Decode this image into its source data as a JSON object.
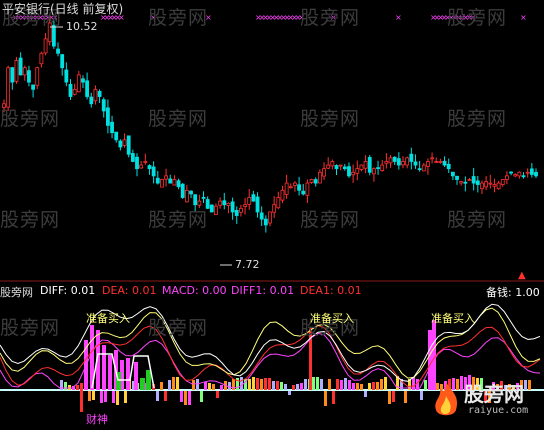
{
  "main": {
    "title": "平安银行(日线 前复权)",
    "high_label": "10.52",
    "low_label": "7.72",
    "watermark": "股旁网",
    "prices": [
      9.4,
      9.9,
      9.7,
      10.0,
      9.8,
      9.9,
      9.7,
      9.6,
      9.9,
      10.1,
      10.3,
      10.52,
      10.2,
      10.1,
      9.9,
      9.7,
      9.5,
      9.6,
      9.8,
      9.7,
      9.5,
      9.4,
      9.6,
      9.5,
      9.3,
      9.1,
      9.0,
      8.9,
      8.8,
      8.9,
      8.7,
      8.6,
      8.5,
      8.55,
      8.6,
      8.5,
      8.4,
      8.3,
      8.35,
      8.4,
      8.3,
      8.35,
      8.25,
      8.1,
      8.2,
      8.15,
      8.0,
      8.05,
      8.1,
      7.95,
      7.9,
      7.98,
      8.05,
      8.0,
      8.02,
      7.9,
      7.85,
      7.95,
      8.0,
      8.1,
      8.05,
      7.9,
      7.8,
      7.72,
      7.9,
      8.0,
      8.1,
      8.2,
      8.3,
      8.25,
      8.3,
      8.2,
      8.15,
      8.3,
      8.35,
      8.3,
      8.45,
      8.5,
      8.55,
      8.6,
      8.5,
      8.55,
      8.5,
      8.4,
      8.45,
      8.5,
      8.55,
      8.6,
      8.45,
      8.5,
      8.5,
      8.55,
      8.6,
      8.65,
      8.6,
      8.55,
      8.6,
      8.65,
      8.6,
      8.55,
      8.5,
      8.55,
      8.6,
      8.65,
      8.6,
      8.6,
      8.55,
      8.5,
      8.4,
      8.35,
      8.32,
      8.3,
      8.35,
      8.3,
      8.28,
      8.3,
      8.32,
      8.3,
      8.28,
      8.3,
      8.35,
      8.4,
      8.45,
      8.42,
      8.45,
      8.4,
      8.45,
      8.42,
      8.4
    ],
    "price_range": [
      7.4,
      10.7
    ]
  },
  "indicator": {
    "name": "股旁网",
    "diff": "DIFF: 0.01",
    "dea": "DEA: 0.01",
    "macd": "MACD: 0.00",
    "diff1": "DIFF1: 0.01",
    "dea1": "DEA1: 0.01",
    "beiqian": "备钱: 1.00",
    "buy_label": "准备买入",
    "caishen": "财神"
  },
  "logo": {
    "name": "股旁网",
    "url": "raiyue.com"
  },
  "colors": {
    "up": "#ff3030",
    "down": "#00e0e0",
    "magenta": "#ff44ff",
    "yellow": "#ffff7a",
    "bg": "#000000"
  }
}
